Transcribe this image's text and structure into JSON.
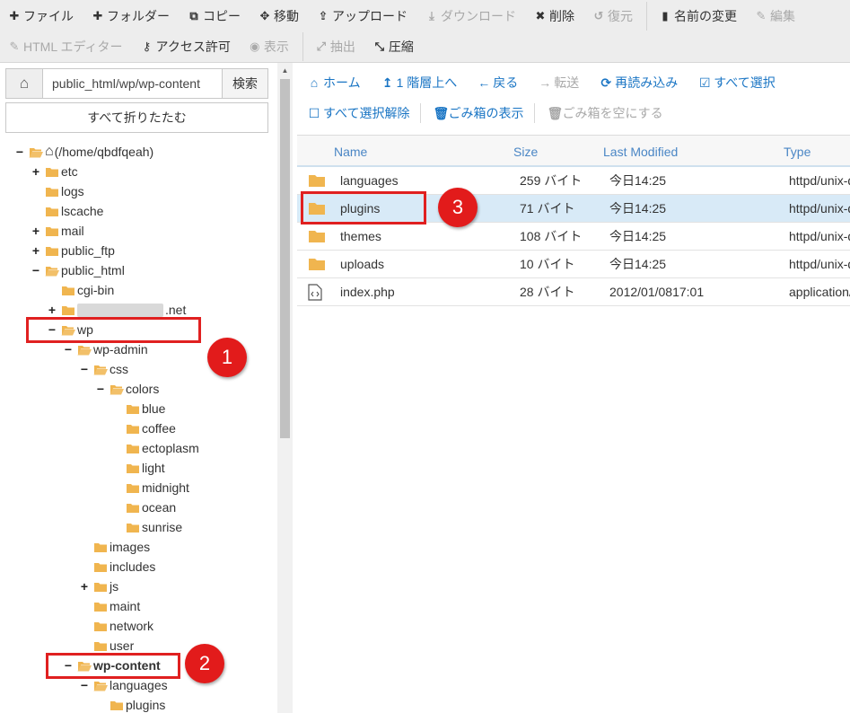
{
  "colors": {
    "folder": "#f0b54f",
    "link": "#1a75c4",
    "disabled": "#a9a9a9",
    "highlight": "#e02020",
    "selected_row": "#d8eaf7"
  },
  "toolbar": {
    "file_label": "ファイル",
    "folder_label": "フォルダー",
    "copy_label": "コピー",
    "move_label": "移動",
    "upload_label": "アップロード",
    "download_label": "ダウンロード",
    "delete_label": "削除",
    "restore_label": "復元",
    "rename_label": "名前の変更",
    "edit_label": "編集",
    "html_editor_label": "HTML エディター",
    "permissions_label": "アクセス許可",
    "view_label": "表示",
    "extract_label": "抽出",
    "compress_label": "圧縮"
  },
  "left": {
    "path_value": "public_html/wp/wp-content",
    "search_label": "検索",
    "collapse_label": "すべて折りたたむ",
    "tree": {
      "root": "(/home/qbdfqeah)",
      "etc": "etc",
      "logs": "logs",
      "lscache": "lscache",
      "mail": "mail",
      "public_ftp": "public_ftp",
      "public_html": "public_html",
      "cgi_bin": "cgi-bin",
      "domain_suffix": ".net",
      "wp": "wp",
      "wp_admin": "wp-admin",
      "css": "css",
      "colors": "colors",
      "blue": "blue",
      "coffee": "coffee",
      "ectoplasm": "ectoplasm",
      "light": "light",
      "midnight": "midnight",
      "ocean": "ocean",
      "sunrise": "sunrise",
      "images": "images",
      "includes": "includes",
      "js": "js",
      "maint": "maint",
      "network": "network",
      "user": "user",
      "wp_content": "wp-content",
      "languages": "languages",
      "plugins": "plugins"
    }
  },
  "right": {
    "home_label": "ホーム",
    "up_label": "1 階層上へ",
    "back_label": "戻る",
    "forward_label": "転送",
    "reload_label": "再読み込み",
    "select_all_label": "すべて選択",
    "deselect_all_label": "すべて選択解除",
    "trash_view_label": "ごみ箱の表示",
    "trash_empty_label": "ごみ箱を空にする",
    "columns": {
      "name": "Name",
      "size": "Size",
      "modified": "Last Modified",
      "type": "Type"
    },
    "files": [
      {
        "name": "languages",
        "size": "259 バイト",
        "modified": "今日14:25",
        "type": "httpd/unix-directory"
      },
      {
        "name": "plugins",
        "size": "71 バイト",
        "modified": "今日14:25",
        "type": "httpd/unix-directory"
      },
      {
        "name": "themes",
        "size": "108 バイト",
        "modified": "今日14:25",
        "type": "httpd/unix-directory"
      },
      {
        "name": "uploads",
        "size": "10 バイト",
        "modified": "今日14:25",
        "type": "httpd/unix-directory"
      },
      {
        "name": "index.php",
        "size": "28 バイト",
        "modified": "2012/01/0817:01",
        "type": "application/x-httpd-php"
      }
    ]
  },
  "annotations": {
    "one": "1",
    "two": "2",
    "three": "3"
  }
}
